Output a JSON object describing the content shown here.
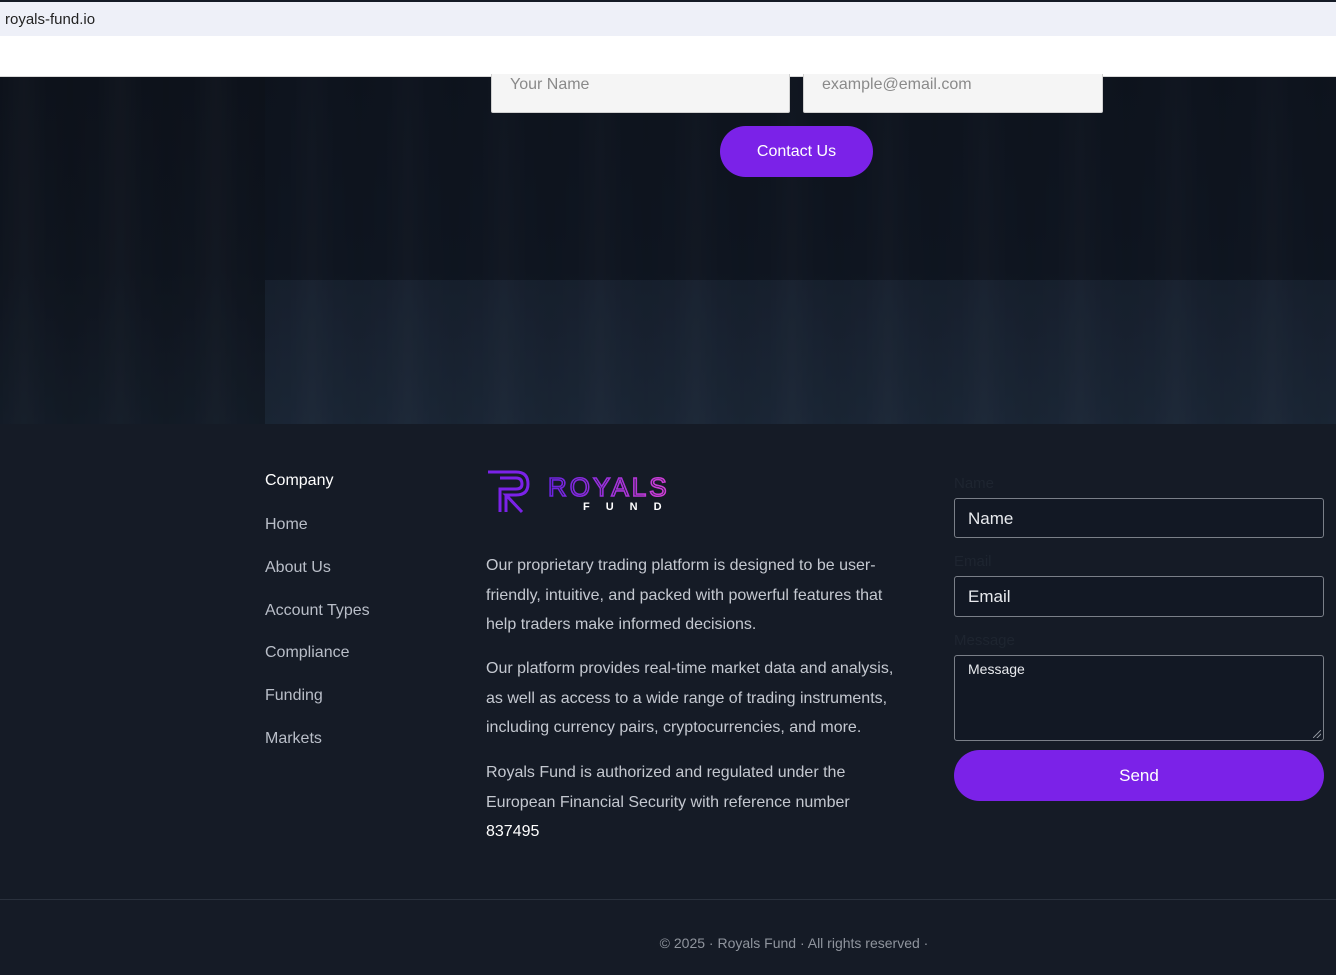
{
  "browser": {
    "url": "royals-fund.io"
  },
  "hero_form": {
    "name_placeholder": "Your Name",
    "email_placeholder": "example@email.com",
    "submit_label": "Contact Us"
  },
  "footer": {
    "company_heading": "Company",
    "links": [
      "Home",
      "About Us",
      "Account Types",
      "Compliance",
      "Funding",
      "Markets"
    ],
    "logo": {
      "word": "ROYALS",
      "sub": "FUND",
      "monogram": "R",
      "colors": {
        "primary": "#7b22e8",
        "accent": "#d23fd6"
      }
    },
    "about_paragraphs": [
      "Our proprietary trading platform is designed to be user-friendly, intuitive, and packed with powerful features that help traders make informed decisions.",
      "Our platform provides real-time market data and analysis, as well as access to a wide range of trading instruments, including currency pairs, cryptocurrencies, and more."
    ],
    "regulation_text": "Royals Fund is authorized and regulated under the European Financial Security with reference number",
    "reference_number": "837495",
    "contact_form": {
      "name_label": "Name",
      "name_placeholder": "Name",
      "email_label": "Email",
      "email_placeholder": "Email",
      "message_label": "Message",
      "message_placeholder": "Message",
      "send_label": "Send"
    },
    "copyright": "© 2025 · Royals Fund · All rights reserved ·"
  },
  "colors": {
    "accent": "#7b22e8",
    "background": "#151b26",
    "text_muted": "#b9bec8"
  }
}
